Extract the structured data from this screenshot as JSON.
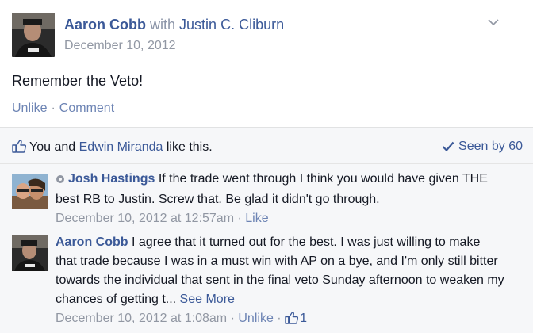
{
  "post": {
    "author": "Aaron Cobb",
    "with_label": "with",
    "tagged": "Justin C. Cliburn",
    "date": "December 10, 2012",
    "text": "Remember the Veto!",
    "actions": {
      "unlike": "Unlike",
      "separator": "·",
      "comment": "Comment"
    }
  },
  "likes": {
    "prefix": "You and",
    "name": "Edwin Miranda",
    "suffix": "like this.",
    "seen": "Seen by 60"
  },
  "comments": [
    {
      "author": "Josh Hastings",
      "text": "If the trade went through I think you would have given THE best RB to Justin. Screw that. Be glad it didn't go through.",
      "time": "December 10, 2012 at 12:57am",
      "separator": "·",
      "action": "Like"
    },
    {
      "author": "Aaron Cobb",
      "text": "I agree that it turned out for the best. I was just willing to make that trade because I was in a must win with AP on a bye, and I'm only still bitter towards the individual that sent in the final veto Sunday afternoon to weaken my chances of getting t...",
      "see_more": "See More",
      "time": "December 10, 2012 at 1:08am",
      "separator": "·",
      "action": "Unlike",
      "like_count": "1"
    }
  ],
  "colors": {
    "link": "#3b5998",
    "muted": "#9197a3",
    "feedback_bg": "#f6f7f9"
  }
}
